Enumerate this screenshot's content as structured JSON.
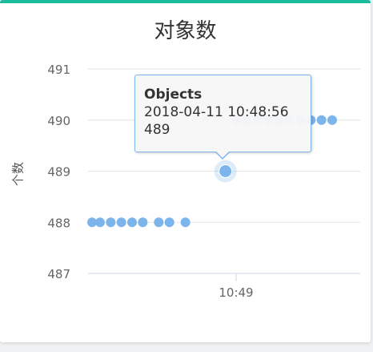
{
  "chart_data": {
    "type": "scatter",
    "title": "对象数",
    "ylabel": "个数",
    "ylim": [
      487,
      491
    ],
    "yticks": [
      487,
      488,
      489,
      490,
      491
    ],
    "xtick_labels": [
      "10:49"
    ],
    "grid": true,
    "series": [
      {
        "name": "Objects",
        "color": "#7cb5ec",
        "x": [
          "10:48:06",
          "10:48:09",
          "10:48:13",
          "10:48:17",
          "10:48:21",
          "10:48:25",
          "10:48:31",
          "10:48:35",
          "10:48:41",
          "10:48:56",
          "10:49:00",
          "10:49:04",
          "10:49:08",
          "10:49:12",
          "10:49:16",
          "10:49:20",
          "10:49:24",
          "10:49:28",
          "10:49:32",
          "10:49:36"
        ],
        "values": [
          488,
          488,
          488,
          488,
          488,
          488,
          488,
          488,
          488,
          489,
          490,
          490,
          490,
          490,
          490,
          490,
          490,
          490,
          490,
          490
        ]
      }
    ]
  },
  "tooltip": {
    "series": "Objects",
    "time": "2018-04-11 10:48:56",
    "value": "489"
  }
}
